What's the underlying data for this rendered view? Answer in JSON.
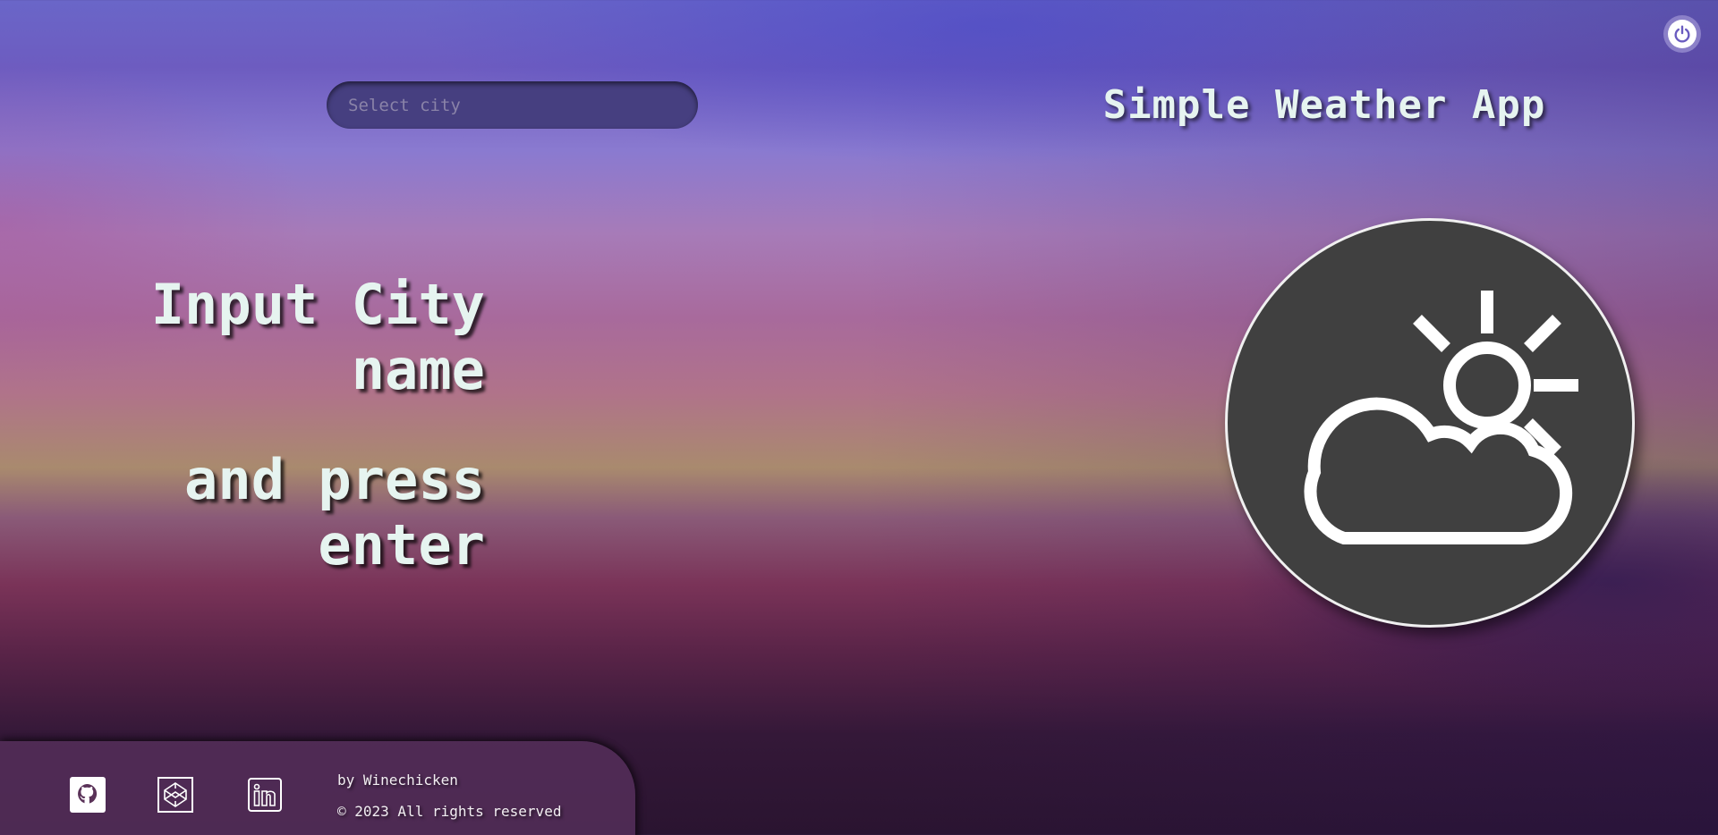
{
  "header": {
    "title": "Simple Weather App"
  },
  "search": {
    "placeholder": "Select city",
    "value": ""
  },
  "prompt": {
    "line1": "Input City",
    "line2": "name",
    "line3": "and press",
    "line4": "enter"
  },
  "weather_icon": {
    "icon": "partly-cloudy-icon",
    "background": "#404040"
  },
  "power_button": {
    "icon": "power-icon"
  },
  "footer": {
    "links": [
      {
        "icon": "github-icon"
      },
      {
        "icon": "codepen-icon"
      },
      {
        "icon": "linkedin-icon"
      }
    ],
    "author": "by Winechicken",
    "copyright": "© 2023 All rights reserved"
  }
}
